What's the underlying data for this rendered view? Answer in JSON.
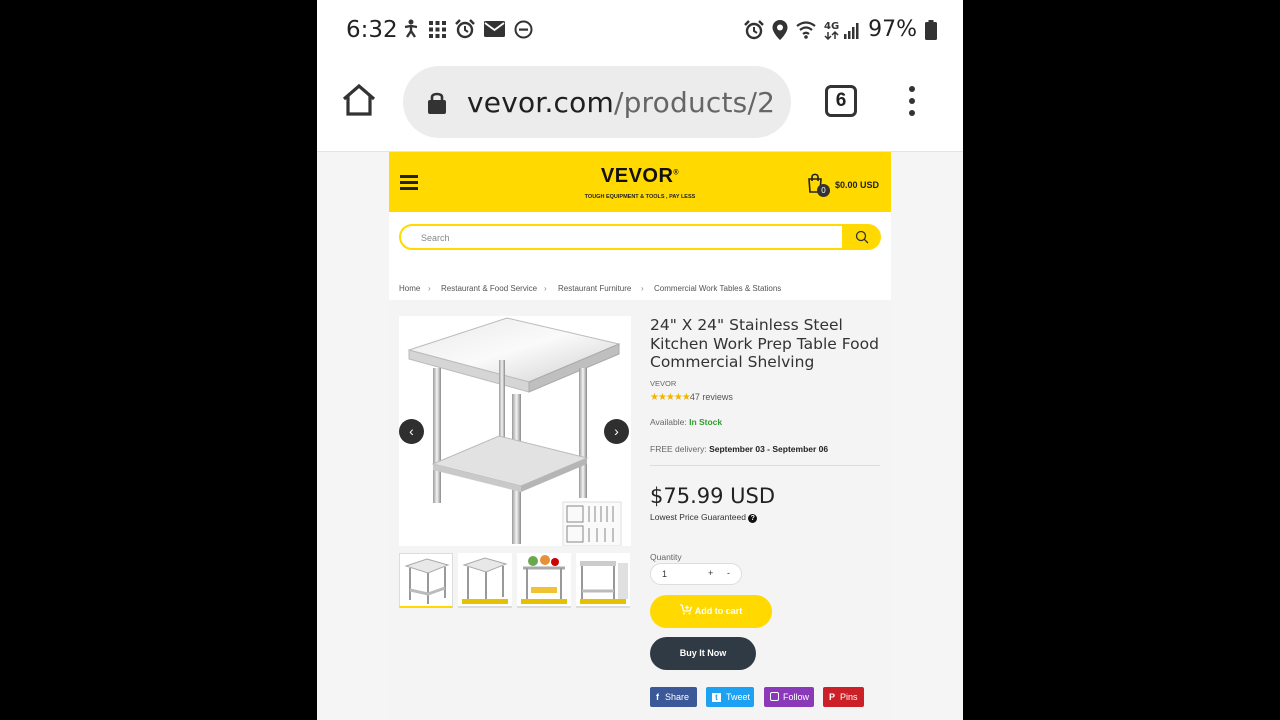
{
  "status_bar": {
    "time": "6:32",
    "battery": "97%",
    "network": "4G"
  },
  "browser": {
    "url_domain": "vevor.com",
    "url_path": "/products/2",
    "tab_count": "6"
  },
  "site": {
    "logo": "VEVOR",
    "logo_mark": "®",
    "tagline": "TOUGH EQUIPMENT & TOOLS , PAY LESS",
    "cart_count": "0",
    "cart_total": "$0.00 USD",
    "search_placeholder": "Search"
  },
  "breadcrumb": [
    "Home",
    "Restaurant & Food Service",
    "Restaurant Furniture",
    "Commercial Work Tables & Stations"
  ],
  "product": {
    "title": "24\" X 24\" Stainless Steel Kitchen Work Prep Table Food Commercial Shelving",
    "brand": "VEVOR",
    "stars": "★★★★★",
    "reviews": "47 reviews",
    "available_label": "Available:",
    "available_value": "In Stock",
    "delivery_label": "FREE delivery:",
    "delivery_value": "September 03 - September 06",
    "price": "$75.99 USD",
    "price_note": "Lowest Price Guaranteed",
    "quantity_label": "Quantity",
    "quantity": "1",
    "add_to_cart": "Add to cart",
    "buy_now": "Buy It Now"
  },
  "social": [
    {
      "label": "Share",
      "icon": "facebook-icon",
      "color": "#3b5998"
    },
    {
      "label": "Tweet",
      "icon": "twitter-icon",
      "color": "#1da1f2"
    },
    {
      "label": "Follow",
      "icon": "instagram-icon",
      "color": "#8a3ab9"
    },
    {
      "label": "Pins",
      "icon": "pinterest-icon",
      "color": "#cb2027"
    }
  ],
  "colors": {
    "brand_yellow": "#ffd900",
    "dark": "#2f3a44",
    "in_stock": "#2e9e2e"
  }
}
